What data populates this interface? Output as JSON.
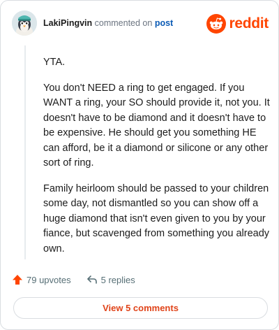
{
  "comment": {
    "author": "LakiPingvin",
    "action_text": "commented on",
    "target_link": "post",
    "paragraphs": [
      "YTA.",
      "You don't NEED a ring to get engaged. If you WANT a ring, your SO should provide it, not you. It doesn't have to be diamond and it doesn't have to be expensive. He should get you something HE can afford, be it a diamond or silicone or any other sort of ring.",
      "Family heirloom should be passed to your children some day, not dismantled so you can show off a huge diamond that isn't even given to you by your fiance, but scavenged from something you already own."
    ]
  },
  "brand": {
    "name": "reddit",
    "icon": "reddit-snoo-icon",
    "color": "#ff4500"
  },
  "actions": {
    "upvotes_label": "79 upvotes",
    "upvote_icon": "upvote-arrow-icon",
    "upvote_color": "#ff4500",
    "replies_label": "5 replies",
    "reply_icon": "reply-arrow-icon"
  },
  "footer": {
    "view_comments_label": "View 5 comments",
    "accent_color": "#e0441a"
  }
}
